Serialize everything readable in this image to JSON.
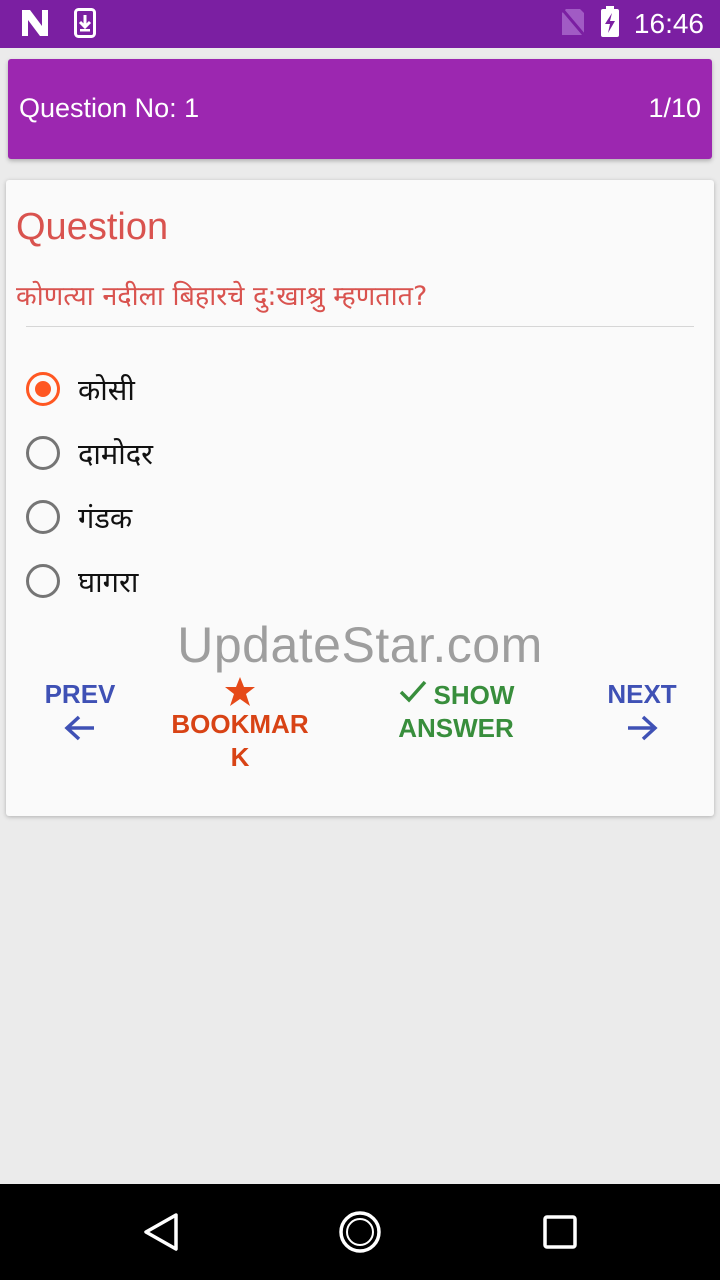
{
  "status_bar": {
    "time": "16:46",
    "icons": [
      "n-icon",
      "download-icon",
      "no-sim-icon",
      "battery-charging-icon"
    ]
  },
  "header": {
    "question_label": "Question No:  1",
    "counter": "1/10"
  },
  "question": {
    "heading": "Question",
    "text": "कोणत्या नदीला बिहारचे दु:खाश्रु म्हणतात?"
  },
  "options": [
    {
      "label": "कोसी",
      "selected": true
    },
    {
      "label": "दामोदर",
      "selected": false
    },
    {
      "label": "गंडक",
      "selected": false
    },
    {
      "label": "घागरा",
      "selected": false
    }
  ],
  "watermark": "UpdateStar.com",
  "actions": {
    "prev": "PREV",
    "bookmark_line1": "BOOKMAR",
    "bookmark_line2": "K",
    "show_line1": "SHOW",
    "show_line2": "ANSWER",
    "next": "NEXT"
  },
  "colors": {
    "status_bar": "#7b1fa2",
    "header": "#9c27b0",
    "question": "#d9534f",
    "radio_selected": "#ff5722",
    "nav": "#3f51b5",
    "bookmark": "#d84315",
    "show_answer": "#388e3c"
  }
}
